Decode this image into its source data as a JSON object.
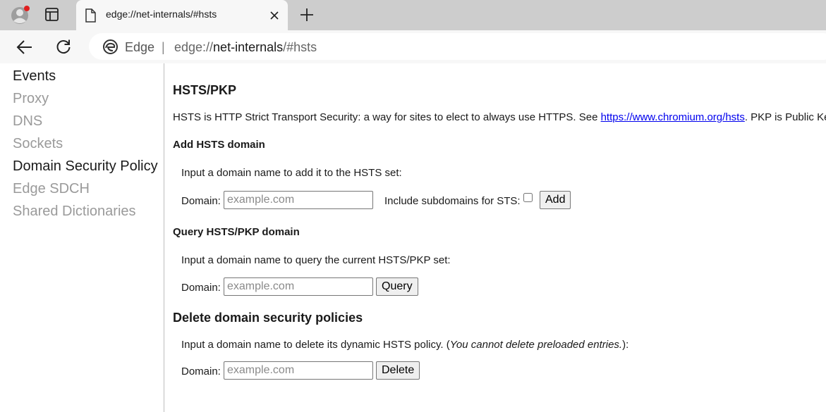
{
  "browser": {
    "tab": {
      "title": "edge://net-internals/#hsts"
    },
    "omnibox": {
      "brand": "Edge",
      "separator": "|",
      "url_scheme": "edge://",
      "url_host": "net-internals",
      "url_path": "/#hsts"
    }
  },
  "sidebar": {
    "items": [
      {
        "label": "Events",
        "state": "enabled"
      },
      {
        "label": "Proxy",
        "state": "dimmed"
      },
      {
        "label": "DNS",
        "state": "dimmed"
      },
      {
        "label": "Sockets",
        "state": "dimmed"
      },
      {
        "label": "Domain Security Policy",
        "state": "selected"
      },
      {
        "label": "Edge SDCH",
        "state": "dimmed"
      },
      {
        "label": "Shared Dictionaries",
        "state": "dimmed"
      }
    ]
  },
  "main": {
    "title": "HSTS/PKP",
    "description_before": "HSTS is HTTP Strict Transport Security: a way for sites to elect to always use HTTPS. See ",
    "description_link": "https://www.chromium.org/hsts",
    "description_after": ". PKP is Public Key Pinning",
    "add": {
      "heading": "Add HSTS domain",
      "instructions": "Input a domain name to add it to the HSTS set:",
      "domain_label": "Domain:",
      "placeholder": "example.com",
      "subdomains_label": "Include subdomains for STS:",
      "subdomains_checked": false,
      "button": "Add"
    },
    "query": {
      "heading": "Query HSTS/PKP domain",
      "instructions": "Input a domain name to query the current HSTS/PKP set:",
      "domain_label": "Domain:",
      "placeholder": "example.com",
      "button": "Query"
    },
    "delete": {
      "heading": "Delete domain security policies",
      "instructions_before": "Input a domain name to delete its dynamic HSTS policy. (",
      "instructions_note": "You cannot delete preloaded entries.",
      "instructions_after": "):",
      "domain_label": "Domain:",
      "placeholder": "example.com",
      "button": "Delete"
    }
  },
  "colors": {
    "tabstrip": "#cdcdcd",
    "toolbar": "#f7f7f7",
    "link": "#0000ee",
    "dimmed_nav": "#9a9a9a",
    "notification_dot": "#e02020"
  }
}
